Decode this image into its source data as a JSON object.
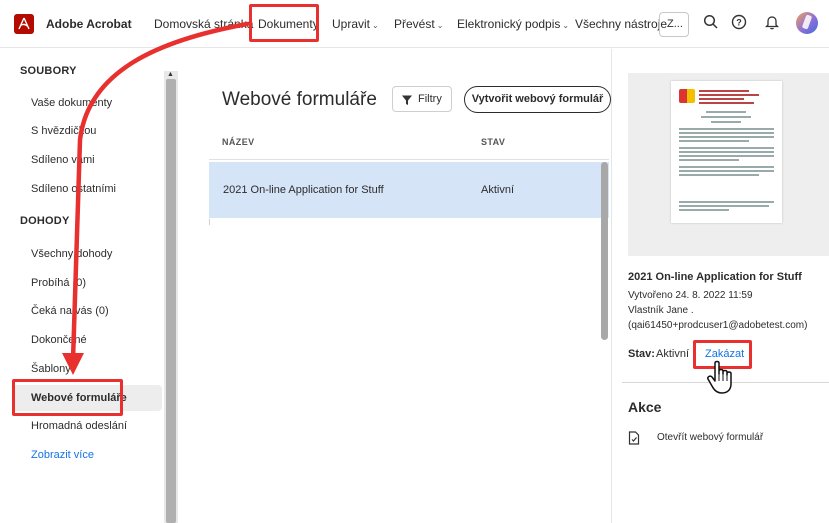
{
  "app": {
    "title": "Adobe Acrobat"
  },
  "nav": {
    "home": "Domovská stránka",
    "documents": "Dokumenty",
    "edit": "Upravit",
    "convert": "Převést",
    "esign": "Elektronický podpis",
    "all_tools": "Všechny nástroje",
    "search_placeholder": "Z..."
  },
  "sidebar": {
    "files_heading": "SOUBORY",
    "files": [
      "Vaše dokumenty",
      "S hvězdičkou",
      "Sdíleno vámi",
      "Sdíleno ostatními"
    ],
    "agreements_heading": "DOHODY",
    "agreements": [
      "Všechny dohody",
      "Probíhá (0)",
      "Čeká na vás (0)",
      "Dokončené",
      "Šablony",
      "Webové formuláře",
      "Hromadná odeslání"
    ],
    "show_more": "Zobrazit více"
  },
  "main": {
    "title": "Webové formuláře",
    "filter_label": "Filtry",
    "create_label": "Vytvořit webový formulář",
    "columns": [
      "NÁZEV",
      "STAV"
    ],
    "rows": [
      {
        "name": "2021 On-line Application for Stuff",
        "status": "Aktivní"
      }
    ]
  },
  "panel": {
    "title": "2021 On-line Application for Stuff",
    "created": "Vytvořeno 24. 8. 2022 11:59",
    "owner": "Vlastník Jane .",
    "email": "(qai61450+prodcuser1@adobetest.com)",
    "status_label": "Stav:",
    "status_value": "Aktivní",
    "disable_label": "Zakázat",
    "actions_heading": "Akce",
    "action_open": "Otevřít webový formulář"
  },
  "colors": {
    "accent": "#1473e6",
    "highlight": "#e8302f",
    "selected_row": "#d6e4f8",
    "brand": "#b30b00"
  }
}
